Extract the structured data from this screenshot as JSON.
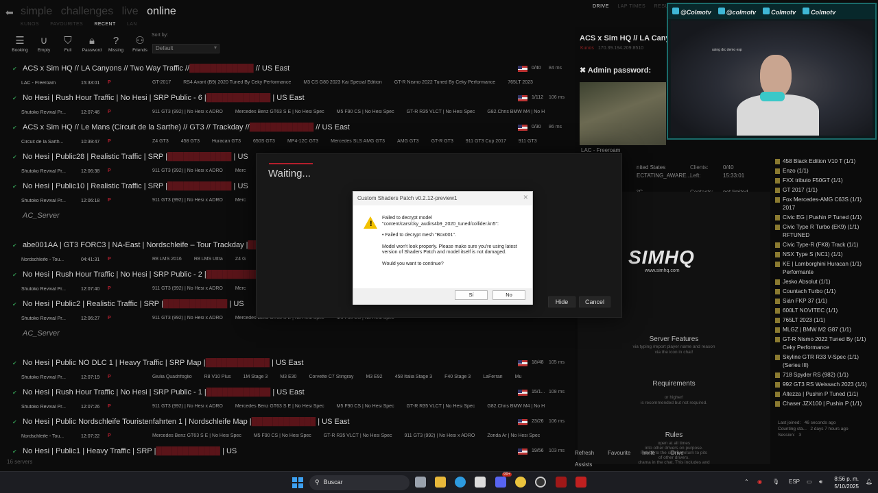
{
  "nav": {
    "title_items": [
      "simple",
      "challenges",
      "live",
      "online"
    ],
    "subtabs": [
      "KUNOS",
      "FAVOURITES",
      "RECENT",
      "LAN"
    ],
    "toolbar": [
      {
        "label": "Booking",
        "icon": "list-icon"
      },
      {
        "label": "Empty",
        "icon": "empty-icon"
      },
      {
        "label": "Full",
        "icon": "full-icon"
      },
      {
        "label": "Password",
        "icon": "lock-icon"
      },
      {
        "label": "Missing",
        "icon": "question-icon"
      },
      {
        "label": "Friends",
        "icon": "friends-icon"
      }
    ],
    "sort_by_label": "Sort by:",
    "sort_value": "Default"
  },
  "servers": [
    {
      "name": "ACS x Sim HQ // LA Canyons // Two Way Traffic //",
      "suffix": " // US East",
      "players": "0/40",
      "ping": "84 ms",
      "track": "LAC - Freeroam",
      "time": "15:33:01",
      "cars": [
        "GT-2017",
        "RS4 Avant (B9) 2020 Tuned By Ceky Performance",
        "M3 CS G80 2023 Kai Special Edition",
        "GT-R Nismo 2022 Tuned By Ceky Performance",
        "765LT 2023"
      ]
    },
    {
      "name": "No Hesi | Rush Hour Traffic | No Hesi | SRP Public - 6 |",
      "suffix": " | US East",
      "players": "1/112",
      "ping": "106 ms",
      "track": "Shutoko Revival Pr...",
      "time": "12:07:46",
      "cars": [
        "911 GT3 (992) | No Hesi x ADRO",
        "Mercedes Benz GT63 S E | No Hesi Spec",
        "M5 F90 CS | No Hesi Spec",
        "GT-R R35 VLCT | No Hesi Spec",
        "G82.Chris BMW M4 | No H"
      ]
    },
    {
      "name": "ACS x Sim HQ // Le Mans (Circuit de la Sarthe) // GT3 // Trackday //",
      "suffix": " // US East",
      "players": "0/30",
      "ping": "86 ms",
      "track": "Circuit de la Sarth...",
      "time": "10:39:47",
      "cars": [
        "Z4 GT3",
        "458 GT3",
        "Huracan GT3",
        "650S GT3",
        "MP4-12C GT3",
        "Mercedes SLS AMG GT3",
        "AMG GT3",
        "GT-R GT3",
        "911 GT3 Cup 2017",
        "911 GT3"
      ]
    },
    {
      "name": "No Hesi | Public28 | Realistic Traffic | SRP |",
      "suffix": " | US",
      "players": "",
      "ping": "",
      "track": "Shutoko Revival Pr...",
      "time": "12:06:38",
      "cars": [
        "911 GT3 (992) | No Hesi x ADRO",
        "Merc"
      ]
    },
    {
      "name": "No Hesi | Public10 | Realistic Traffic | SRP |",
      "suffix": " | US",
      "players": "",
      "ping": "",
      "track": "Shutoko Revival Pr...",
      "time": "12:06:18",
      "cars": [
        "911 GT3 (992) | No Hesi x ADRO",
        "Merc"
      ]
    }
  ],
  "section1": "AC_Server",
  "servers2": [
    {
      "name": "abe001AA | GT3 FORC3 | NA-East | Nordschleife – Tour Trackday |",
      "suffix": "",
      "players": "",
      "ping": "",
      "track": "Nordschleife - Tou...",
      "time": "04:41:31",
      "cars": [
        "R8 LMS 2016",
        "R8 LMS Ultra",
        "Z4 G"
      ]
    },
    {
      "name": "No Hesi | Rush Hour Traffic | No Hesi | SRP Public - 2 |",
      "suffix": "",
      "players": "",
      "ping": "",
      "track": "Shutoko Revival Pr...",
      "time": "12:07:40",
      "cars": [
        "911 GT3 (992) | No Hesi x ADRO",
        "Merc"
      ]
    },
    {
      "name": "No Hesi | Public2 | Realistic Traffic | SRP |",
      "suffix": " | US",
      "players": "",
      "ping": "",
      "track": "Shutoko Revival Pr...",
      "time": "12:06:27",
      "cars": [
        "911 GT3 (992) | No Hesi x ADRO",
        "Mercedes Benz GT63 S E | No Hesi Spec",
        "M5 F90 CS | No Hesi Spec"
      ]
    }
  ],
  "section2": "AC_Server",
  "servers3": [
    {
      "name": "No Hesi | Public NO DLC 1 | Heavy Traffic | SRP Map |",
      "suffix": " | US East",
      "players": "18/48",
      "ping": "105 ms",
      "track": "Shutoko Revival Pr...",
      "time": "12:07:19",
      "cars": [
        "Giulia Quadrifoglio",
        "R8 V10 Plus",
        "1M Stage 3",
        "M3 E30",
        "Corvette C7 Stingray",
        "M3 E92",
        "458 Italia Stage 3",
        "F40 Stage 3",
        "LaFerrari",
        "Mu"
      ]
    },
    {
      "name": "No Hesi | Rush Hour Traffic | No Hesi | SRP Public - 1 |",
      "suffix": " | US East",
      "players": "15/1...",
      "ping": "108 ms",
      "track": "Shutoko Revival Pr...",
      "time": "12:07:26",
      "cars": [
        "911 GT3 (992) | No Hesi x ADRO",
        "Mercedes Benz GT63 S E | No Hesi Spec",
        "M5 F90 CS | No Hesi Spec",
        "GT-R R35 VLCT | No Hesi Spec",
        "G82.Chris BMW M4 | No H"
      ]
    },
    {
      "name": "No Hesi | Public Nordschleife Touristenfahrten 1 | Nordschleife Map |",
      "suffix": " | US East",
      "players": "23/26",
      "ping": "106 ms",
      "track": "Nordschleife - Tou...",
      "time": "12:07:22",
      "cars": [
        "Mercedes Benz GT63 S E | No Hesi Spec",
        "M5 F90 CS | No Hesi Spec",
        "GT-R R35 VLCT | No Hesi Spec",
        "911 GT3 (992) | No Hesi x ADRO",
        "Zonda Ar | No Hesi Spec"
      ]
    },
    {
      "name": "No Hesi | Public1 | Heavy Traffic | SRP |",
      "suffix": " | US",
      "players": "19/56",
      "ping": "103 ms",
      "track": "",
      "time": "",
      "cars": []
    }
  ],
  "servers_count": "16 servers",
  "right": {
    "tabs": [
      "DRIVE",
      "LAP TIMES",
      "RESULTS"
    ],
    "title": "ACS x Sim HQ // LA Canyo",
    "address": "170.39.194.209:8510",
    "admin_label": "Admin password:",
    "thumb_caption": "LAC - Freeroam",
    "info": [
      {
        "k": "",
        "v": "nited States",
        "k2": "Clients:",
        "v2": "0/40"
      },
      {
        "k": "",
        "v": "ECTATING_AWARE...",
        "k2": "Left:",
        "v2": "15:33:01"
      },
      {
        "k": "",
        "v": "",
        "k2": "",
        "v2": ""
      },
      {
        "k": "",
        "v": "°C",
        "k2": "Contacts:",
        "v2": "not limited"
      },
      {
        "k": "",
        "v": "°C",
        "k2": "Wind:",
        "v2": "4 km/h (NE)"
      },
      {
        "k": "",
        "v": "",
        "k2": "Grip:",
        "v2": "100.0%"
      }
    ],
    "banner": {
      "logo": "SIMHQ",
      "url": "www.simhq.com",
      "features_title": "Server Features",
      "features_text1": "via typing /report player name and reason",
      "features_text2": "via the         icon in chat!",
      "req_title": "Requirements",
      "req_text1": "or higher!",
      "req_text2": "is recommended but not required.",
      "rules_title": "Rules",
      "rules": [
        "open at all times",
        "into other drivers on purpose.",
        "Pull off to the side or return to pits",
        "of other drivers.",
        "drama in the chat. This includes              and",
        "If you don't respect these rules, we will have to kick or ban you if excessive"
      ]
    },
    "cars": [
      "458 Black Edition V10 T (1/1)",
      "Enzo (1/1)",
      "FXX tributo F50GT (1/1)",
      "GT 2017 (1/1)",
      "Fox Mercedes-AMG C63S (1/1) 2017",
      "Civic EG | Pushin P Tuned (1/1)",
      "Civic Type R Turbo (EK9) (1/1) RFTUNED",
      "Civic Type-R (FK8) Track (1/1)",
      "NSX Type S (NC1) (1/1)",
      "KE | Lamborghini Huracan (1/1) Performante",
      "Jesko Absolut (1/1)",
      "Countach Turbo (1/1)",
      "Sián FKP 37 (1/1)",
      "600LT NOVITEC (1/1)",
      "765LT 2023 (1/1)",
      "MLGZ | BMW M2 G87 (1/1)",
      "GT-R Nismo 2022 Tuned By (1/1) Ceky Performance",
      "Skyline GTR R33 V-Spec (1/1) (Series III)",
      "718 Spyder RS (982) (1/1)",
      "992 GT3 RS Weissach 2023 (1/1)",
      "Altezza | Pushin P Tuned (1/1)",
      "Chaser JZX100 | Pushin P (1/1)"
    ],
    "stats": [
      {
        "k": "Last joined:",
        "v": "46 seconds ago"
      },
      {
        "k": "Counting sta...",
        "v": "2 days 7 hours ago"
      },
      {
        "k": "Session:",
        "v": "3"
      }
    ],
    "bottom": [
      "Refresh",
      "Favourite",
      "Invite",
      "Drive",
      "Assists"
    ]
  },
  "cam": {
    "handles": [
      "@Colmotv",
      "@colmotv",
      "Colmotv",
      "Colmotv"
    ],
    "overlay_text": "using drc demo esp"
  },
  "waiting": {
    "title": "Waiting...",
    "hide": "Hide",
    "cancel": "Cancel"
  },
  "msgbox": {
    "title": "Custom Shaders Patch v0.2.12-preview1",
    "line1": "Failed to decrypt model \"content/cars/cky_audirs4b9_2020_tuned/collider.kn5\":",
    "line2": "• Failed to decrypt mesh \"Box001\".",
    "line3": "Model won't look properly. Please make sure you're using latest version of Shaders Patch and model itself is not damaged.",
    "line4": "Would you want to continue?",
    "yes": "Sí",
    "no": "No"
  },
  "taskbar": {
    "search": "Buscar",
    "lang": "ESP",
    "time": "8:56 p. m.",
    "date": "5/10/2025",
    "badge": "99+"
  }
}
